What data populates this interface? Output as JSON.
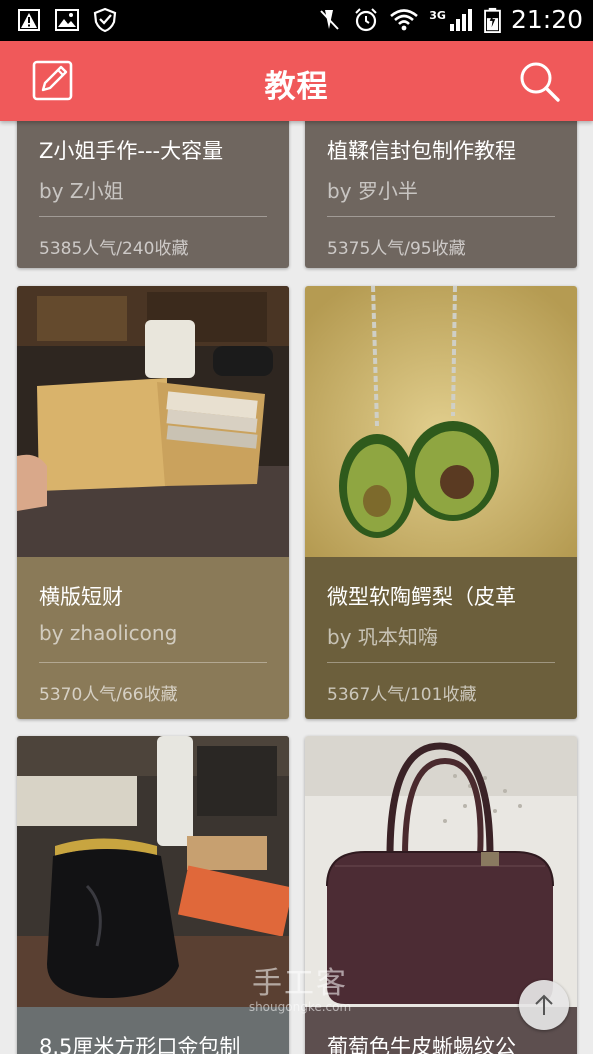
{
  "status_bar": {
    "time": "21:20",
    "network": "3G",
    "icons": [
      "warning-icon",
      "image-icon",
      "shield-icon",
      "mute-icon",
      "alarm-icon",
      "wifi-icon",
      "signal-icon",
      "battery-icon"
    ]
  },
  "app_bar": {
    "title": "教程",
    "left_icon": "edit-icon",
    "right_icon": "search-icon",
    "color": "#f0595a"
  },
  "cards": [
    {
      "title": "Z小姐手作---大容量",
      "author": "by Z小姐",
      "stats": "5385人气/240收藏",
      "info_color": "#6f665f"
    },
    {
      "title": "植鞣信封包制作教程",
      "author": "by 罗小半",
      "stats": "5375人气/95收藏",
      "info_color": "#6f665f"
    },
    {
      "title": "横版短财",
      "author": "by zhaolicong",
      "stats": "5370人气/66收藏",
      "info_color": "#8a7a58"
    },
    {
      "title": "微型软陶鳄梨（皮革",
      "author": "by 巩本知嗨",
      "stats": "5367人气/101收藏",
      "info_color": "#6c5f3c"
    },
    {
      "title": "8.5厘米方形口金包制",
      "author": "",
      "stats": "",
      "info_color": "#6a6f70"
    },
    {
      "title": "葡萄色牛皮蜥蜴纹公",
      "author": "",
      "stats": "",
      "info_color": "#5d4f4f"
    }
  ],
  "watermark": {
    "big": "手工客",
    "small": "shougongke.com"
  },
  "back_to_top_icon": "arrow-up-icon"
}
